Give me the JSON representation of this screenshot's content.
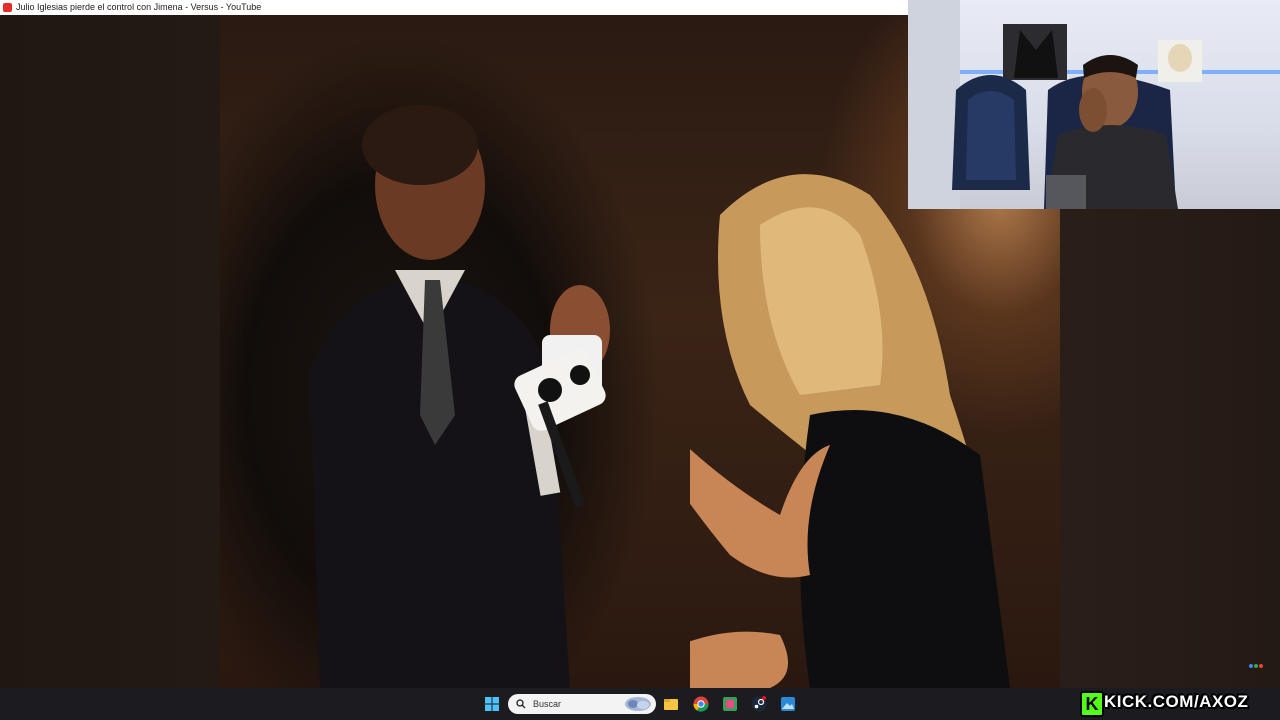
{
  "window": {
    "title": "Julio Iglesias pierde el control con Jimena - Versus - YouTube"
  },
  "taskbar": {
    "search_placeholder": "Buscar",
    "icons": [
      "windows-start-icon",
      "search-icon",
      "search-highlight-icon",
      "file-explorer-icon",
      "chrome-icon",
      "app-icon",
      "steam-icon",
      "photos-icon"
    ]
  },
  "watermark": {
    "letter": "K",
    "text": "KICK.COM/AXOZ",
    "accent": "#53fc18"
  },
  "colors": {
    "youtube_red": "#e52d27",
    "taskbar": "#1c1c20"
  }
}
